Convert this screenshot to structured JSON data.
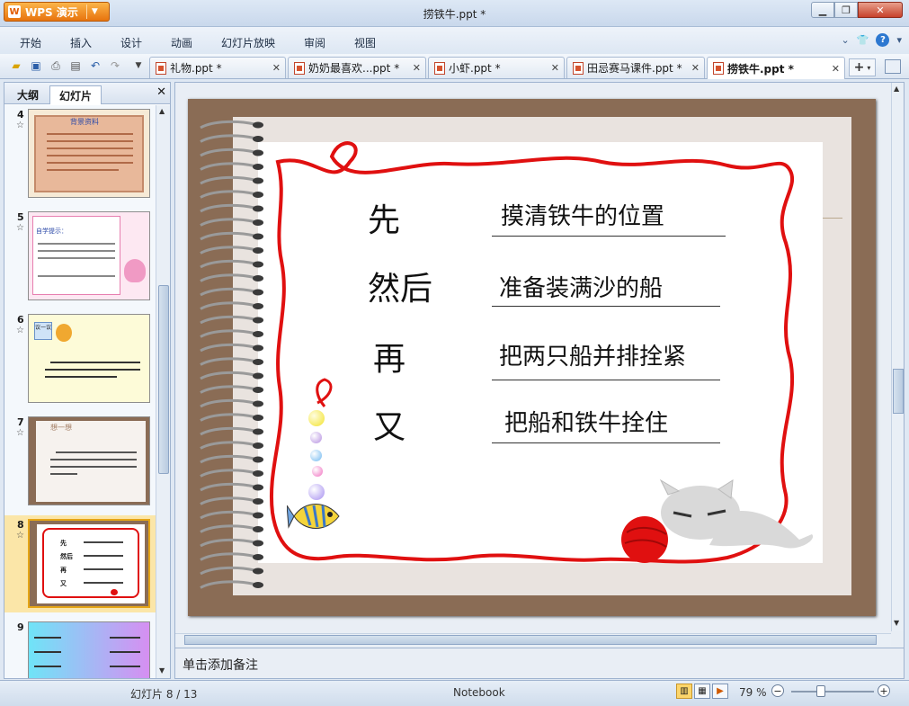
{
  "app": {
    "name": "WPS 演示",
    "window_title": "捞铁牛.ppt *"
  },
  "menu": [
    "开始",
    "插入",
    "设计",
    "动画",
    "幻灯片放映",
    "审阅",
    "视图"
  ],
  "tabs": [
    {
      "label": "礼物.ppt *",
      "active": false
    },
    {
      "label": "奶奶最喜欢...ppt *",
      "active": false
    },
    {
      "label": "小虾.ppt *",
      "active": false
    },
    {
      "label": "田忌赛马课件.ppt *",
      "active": false
    },
    {
      "label": "捞铁牛.ppt *",
      "active": true
    }
  ],
  "panel": {
    "tab_outline": "大纲",
    "tab_slides": "幻灯片"
  },
  "thumbnails": [
    {
      "num": "4",
      "star": "☆",
      "selected": false,
      "title": "背景资料"
    },
    {
      "num": "5",
      "star": "☆",
      "selected": false,
      "title": "自学提示："
    },
    {
      "num": "6",
      "star": "☆",
      "selected": false,
      "title": "议一议"
    },
    {
      "num": "7",
      "star": "☆",
      "selected": false,
      "title": "想一想"
    },
    {
      "num": "8",
      "star": "☆",
      "selected": true,
      "title": ""
    },
    {
      "num": "9",
      "star": "",
      "selected": false,
      "title": ""
    }
  ],
  "slide": {
    "rows": [
      {
        "word": "先",
        "phrase": "摸清铁牛的位置"
      },
      {
        "word": "然后",
        "phrase": "准备装满沙的船"
      },
      {
        "word": "再",
        "phrase": "把两只船并排拴紧"
      },
      {
        "word": "又",
        "phrase": "把船和铁牛拴住"
      }
    ]
  },
  "notes_placeholder": "单击添加备注",
  "status": {
    "slide_counter": "幻灯片 8 / 13",
    "theme": "Notebook",
    "zoom": "79 %"
  },
  "colors": {
    "frame": "#8a6c55",
    "string": "#e01010",
    "accent": "#e8730d"
  }
}
